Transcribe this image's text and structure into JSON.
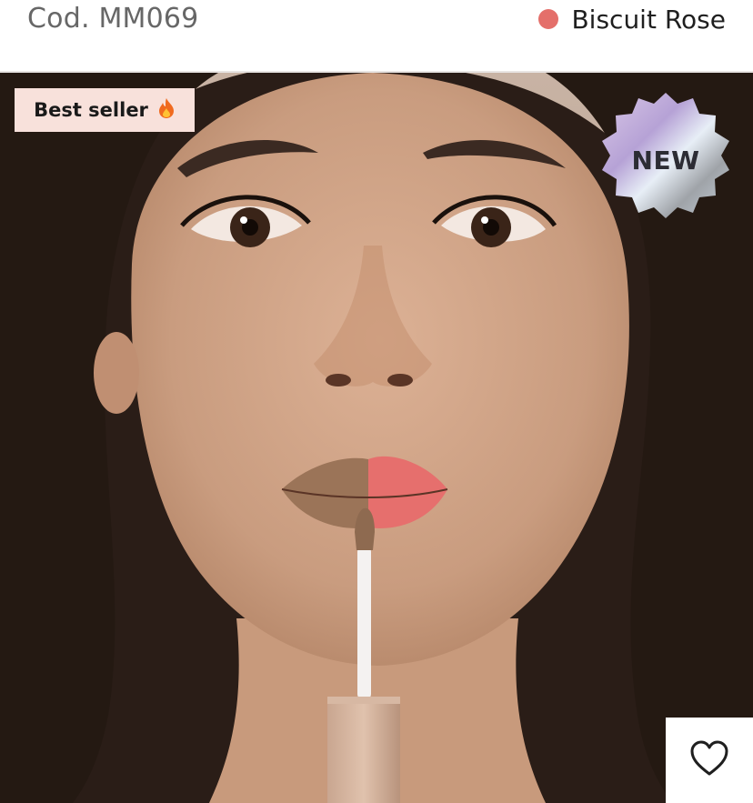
{
  "product": {
    "code_label": "Cod.",
    "code_value": "MM069",
    "shade_name": "Biscuit Rose",
    "shade_color": "#e46f6a"
  },
  "badges": {
    "best_seller": "Best seller",
    "best_seller_icon": "fire-icon",
    "new": "NEW"
  },
  "actions": {
    "favorite_icon": "heart-icon"
  },
  "colors": {
    "lip_left": "#9b7458",
    "lip_right": "#e66f6d",
    "best_seller_bg": "#f8e1db"
  }
}
